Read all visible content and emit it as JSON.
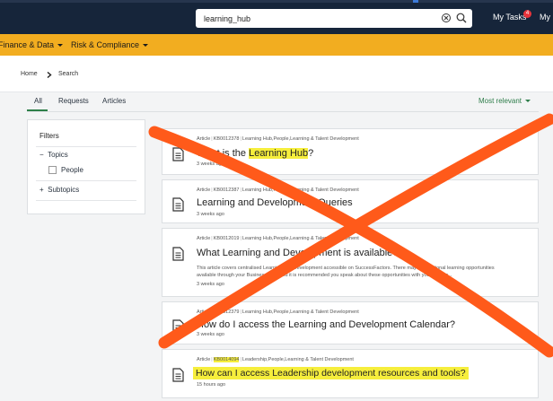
{
  "topbar": {
    "search_value": "learning_hub",
    "my_tasks_label": "My Tasks",
    "my_tasks_count": "4",
    "my_truncated_label": "My"
  },
  "menubar": {
    "items": [
      {
        "label": "Finance & Data"
      },
      {
        "label": "Risk & Compliance"
      }
    ]
  },
  "breadcrumb": {
    "home": "Home",
    "current": "Search"
  },
  "tabs": [
    {
      "label": "All",
      "active": true
    },
    {
      "label": "Requests",
      "active": false
    },
    {
      "label": "Articles",
      "active": false
    }
  ],
  "sort": {
    "label": "Most relevant"
  },
  "filters": {
    "title": "Filters",
    "topics_label": "Topics",
    "topics_toggle": "−",
    "people_label": "People",
    "subtopics_label": "Subtopics",
    "subtopics_toggle": "+"
  },
  "results": [
    {
      "type": "Article",
      "kb": "KB0012378",
      "topics": "Learning Hub,People,Learning & Talent Development",
      "title_pre": "What is the ",
      "title_hl": "Learning Hub",
      "title_post": "?",
      "ago": "3 weeks ago"
    },
    {
      "type": "Article",
      "kb": "KB0012387",
      "topics": "Learning Hub,People,Learning & Talent Development",
      "title": "Learning and Development Queries",
      "ago": "3 weeks ago"
    },
    {
      "type": "Article",
      "kb": "KB0012019",
      "topics": "Learning Hub,People,Learning & Talent Development",
      "title": "What Learning and Development is available?",
      "desc": "This article covers centralised Learning and Development accessible on SuccessFactors. There may be additional learning opportunities available through your Business Unit, and it is recommended you speak about these opportunities with your Leader...",
      "ago": "3 weeks ago"
    },
    {
      "type": "Article",
      "kb": "KB0012379",
      "topics": "Learning Hub,People,Learning & Talent Development",
      "title": "How do I access the Learning and Development Calendar?",
      "ago": "3 weeks ago"
    },
    {
      "type": "Article",
      "kb": "KB0014094",
      "topics": "Leadership,People,Learning & Talent Development",
      "title": "How can I access Leadership development resources and tools?",
      "ago": "15 hours ago"
    }
  ],
  "colors": {
    "nav": "#16253a",
    "menubar": "#f2ad20",
    "accent": "#2e8049",
    "highlight": "#f6ee3c",
    "cross": "#ff5a1a"
  }
}
